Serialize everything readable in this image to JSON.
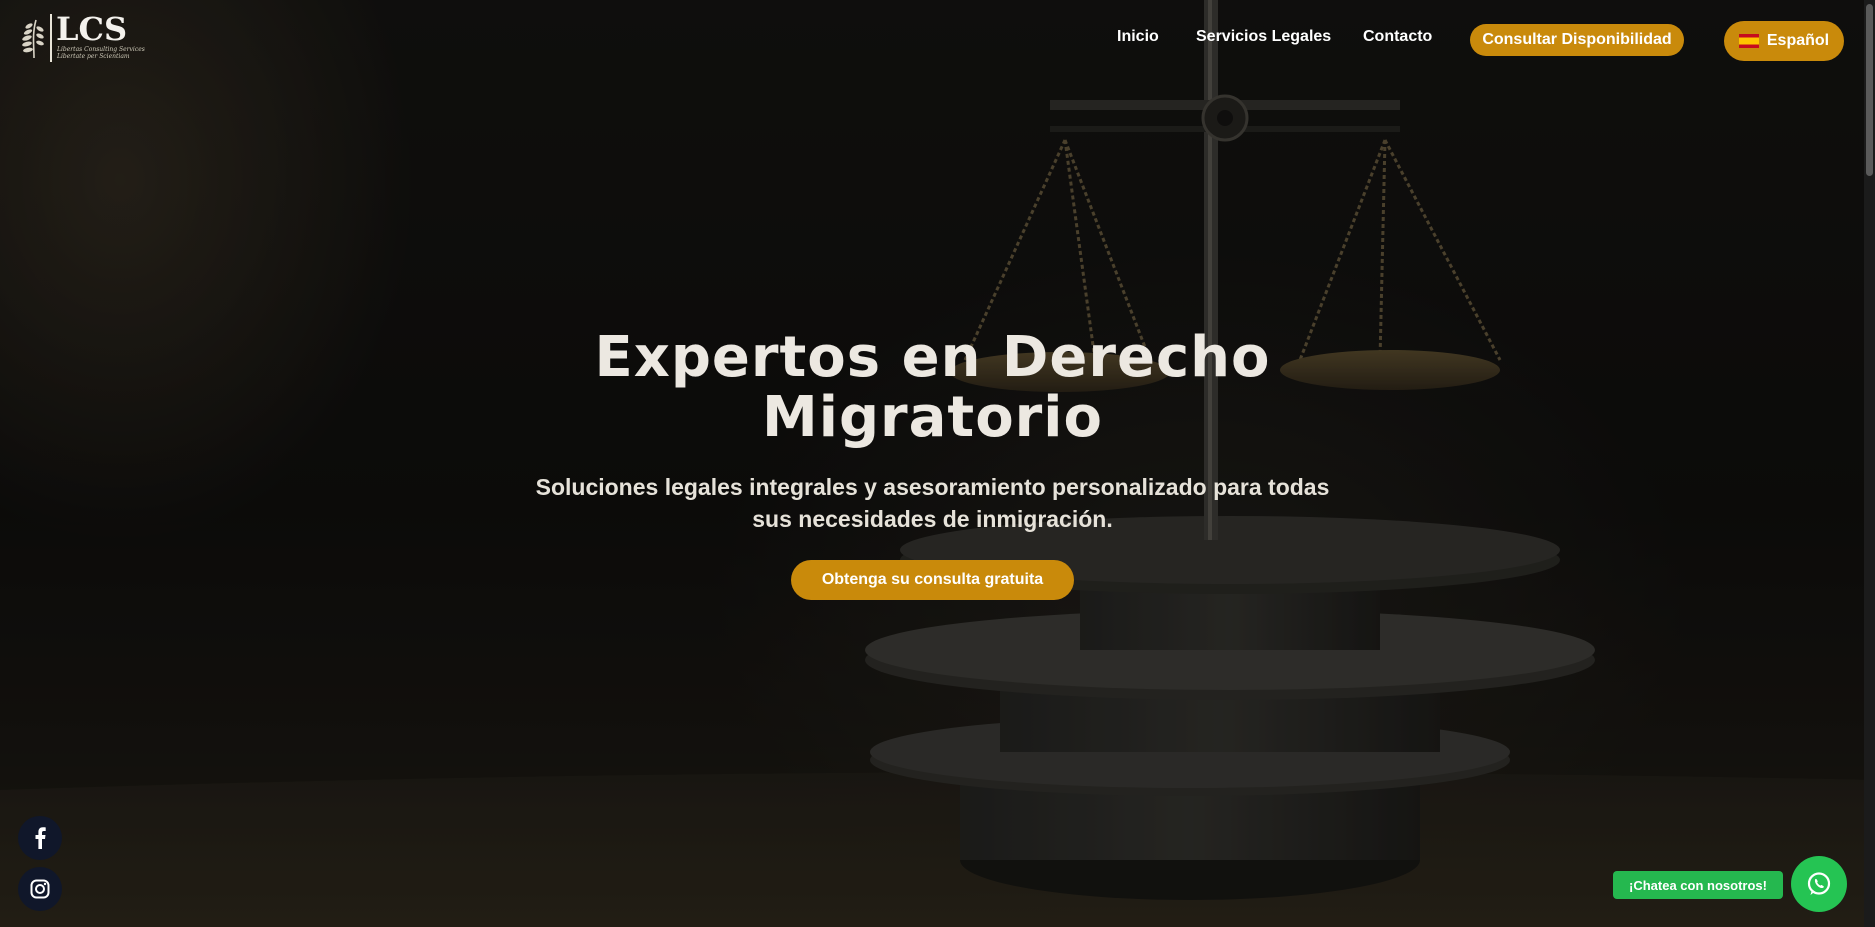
{
  "logo": {
    "mark": "LCS",
    "tagline_1": "Libertas Consulting Services",
    "tagline_2": "Libertate per Scientiam",
    "icon": "laurel-icon"
  },
  "nav": {
    "items": [
      {
        "label": "Inicio"
      },
      {
        "label": "Servicios Legales"
      },
      {
        "label": "Contacto"
      }
    ],
    "cta_label": "Consultar Disponibilidad",
    "language": {
      "label": "Español",
      "icon": "spain-flag-icon"
    }
  },
  "hero": {
    "title": "Expertos en Derecho Migratorio",
    "subtitle": "Soluciones legales integrales y asesoramiento personalizado para todas sus necesidades de inmigración.",
    "cta_label": "Obtenga su consulta gratuita"
  },
  "social": [
    {
      "icon": "facebook-icon"
    },
    {
      "icon": "instagram-icon"
    }
  ],
  "chat": {
    "label": "¡Chatea con nosotros!",
    "icon": "whatsapp-icon"
  },
  "colors": {
    "accent": "#c98a0b",
    "chat_green": "#25c453",
    "social_bg": "#10172a"
  }
}
